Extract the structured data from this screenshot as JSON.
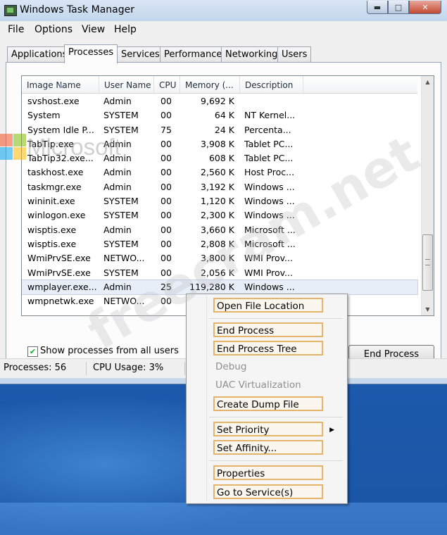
{
  "window": {
    "title": "Windows Task Manager",
    "caption_buttons": [
      "minimize-icon",
      "maximize-icon",
      "close-icon"
    ]
  },
  "menu": {
    "items": [
      "File",
      "Options",
      "View",
      "Help"
    ]
  },
  "tabs": [
    "Applications",
    "Processes",
    "Services",
    "Performance",
    "Networking",
    "Users"
  ],
  "active_tab": "Processes",
  "columns": [
    "Image Name",
    "User Name",
    "CPU",
    "Memory (...",
    "Description"
  ],
  "processes": [
    {
      "name": "svshost.exe",
      "user": "Admin",
      "cpu": "00",
      "mem": "9,692 K",
      "desc": ""
    },
    {
      "name": "System",
      "user": "SYSTEM",
      "cpu": "00",
      "mem": "64 K",
      "desc": "NT Kernel..."
    },
    {
      "name": "System Idle P...",
      "user": "SYSTEM",
      "cpu": "75",
      "mem": "24 K",
      "desc": "Percenta..."
    },
    {
      "name": "TabTip.exe",
      "user": "Admin",
      "cpu": "00",
      "mem": "3,908 K",
      "desc": "Tablet PC..."
    },
    {
      "name": "TabTip32.exe...",
      "user": "Admin",
      "cpu": "00",
      "mem": "608 K",
      "desc": "Tablet PC..."
    },
    {
      "name": "taskhost.exe",
      "user": "Admin",
      "cpu": "00",
      "mem": "2,560 K",
      "desc": "Host Proc..."
    },
    {
      "name": "taskmgr.exe",
      "user": "Admin",
      "cpu": "00",
      "mem": "3,192 K",
      "desc": "Windows ..."
    },
    {
      "name": "wininit.exe",
      "user": "SYSTEM",
      "cpu": "00",
      "mem": "1,120 K",
      "desc": "Windows ..."
    },
    {
      "name": "winlogon.exe",
      "user": "SYSTEM",
      "cpu": "00",
      "mem": "2,300 K",
      "desc": "Windows ..."
    },
    {
      "name": "wisptis.exe",
      "user": "Admin",
      "cpu": "00",
      "mem": "3,660 K",
      "desc": "Microsoft ..."
    },
    {
      "name": "wisptis.exe",
      "user": "SYSTEM",
      "cpu": "00",
      "mem": "2,808 K",
      "desc": "Microsoft ..."
    },
    {
      "name": "WmiPrvSE.exe",
      "user": "NETWO...",
      "cpu": "00",
      "mem": "3,800 K",
      "desc": "WMI Prov..."
    },
    {
      "name": "WmiPrvSE.exe",
      "user": "SYSTEM",
      "cpu": "00",
      "mem": "2,056 K",
      "desc": "WMI Prov..."
    },
    {
      "name": "wmplayer.exe...",
      "user": "Admin",
      "cpu": "25",
      "mem": "119,280 K",
      "desc": "Windows ..."
    },
    {
      "name": "wmpnetwk.exe",
      "user": "NETWO...",
      "cpu": "00",
      "mem": "",
      "desc": ""
    }
  ],
  "selected_row_index": 13,
  "show_all_users": {
    "label": "Show processes from all users",
    "checked": true
  },
  "end_process_button": "End Process",
  "status": {
    "processes": "Processes: 56",
    "cpu": "CPU Usage: 3%"
  },
  "context_menu": {
    "items": [
      {
        "label": "Open File Location",
        "enabled": true
      },
      {
        "label": "End Process",
        "enabled": true
      },
      {
        "label": "End Process Tree",
        "enabled": true
      },
      {
        "label": "Debug",
        "enabled": false
      },
      {
        "label": "UAC Virtualization",
        "enabled": false
      },
      {
        "label": "Create Dump File",
        "enabled": true
      },
      {
        "label": "Set Priority",
        "enabled": true,
        "submenu": true
      },
      {
        "label": "Set Affinity...",
        "enabled": true
      },
      {
        "label": "Properties",
        "enabled": true
      },
      {
        "label": "Go to Service(s)",
        "enabled": true
      }
    ],
    "highlight_color": "#e5b46a"
  },
  "watermark": {
    "logo_text": "Microsoft",
    "site_text": "freecram.net"
  }
}
